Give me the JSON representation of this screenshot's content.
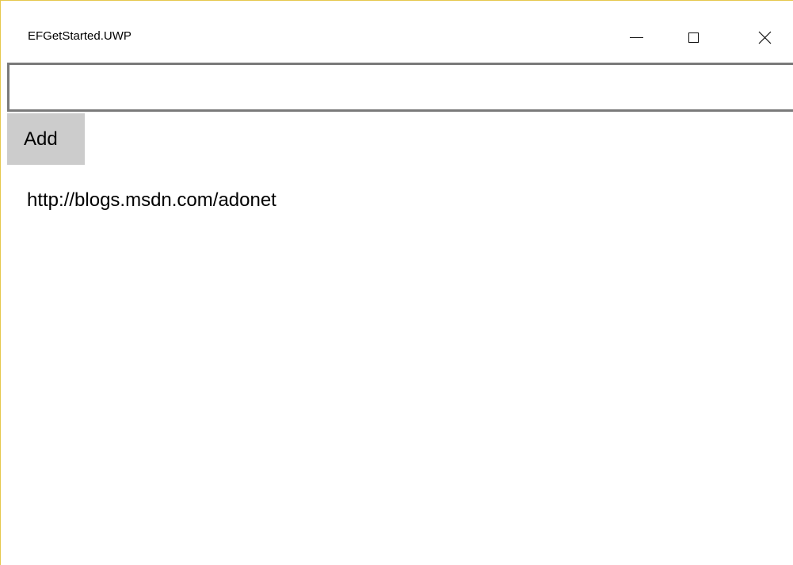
{
  "window": {
    "title": "EFGetStarted.UWP",
    "controls": {
      "minimize": "minimize-icon",
      "maximize": "maximize-icon",
      "close": "close-icon"
    },
    "accent_border_color": "#e6c84e"
  },
  "form": {
    "input_value": "",
    "add_label": "Add"
  },
  "blogs": [
    {
      "url": "http://blogs.msdn.com/adonet"
    }
  ]
}
